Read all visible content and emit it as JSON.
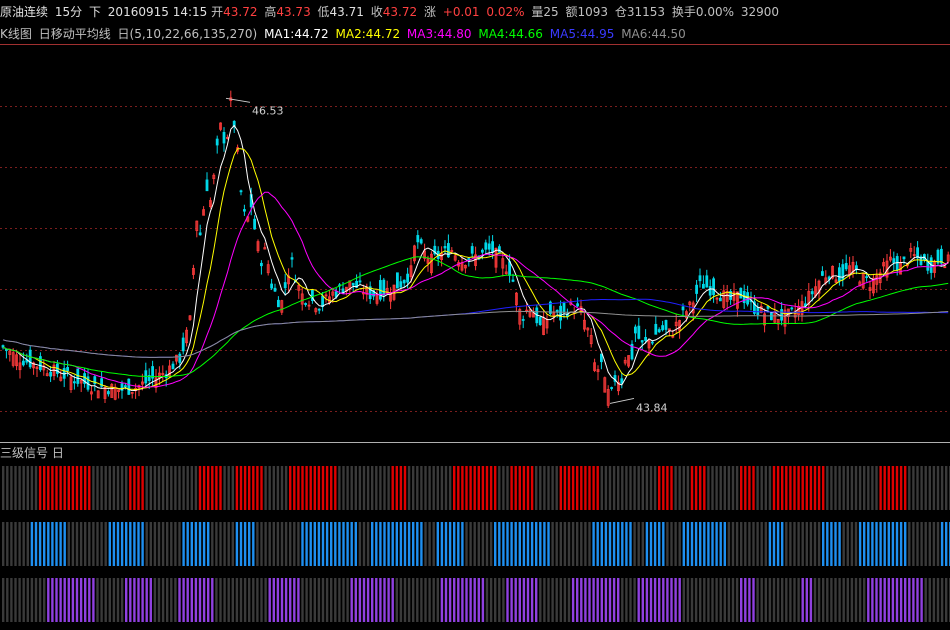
{
  "header": {
    "symbol": "原油连续",
    "period": "15分",
    "direction": "下",
    "date": "20160915",
    "time": "14:15",
    "open_label": "开",
    "open": "43.72",
    "high_label": "高",
    "high": "43.73",
    "low_label": "低",
    "low": "43.71",
    "close_label": "收",
    "close": "43.72",
    "change_label": "涨",
    "change": "+0.01",
    "change_pct": "0.02%",
    "volume_label": "量",
    "volume": "25",
    "amount_label": "额",
    "amount": "1093",
    "oi_label": "仓",
    "oi": "31153",
    "turnover_label": "换手",
    "turnover": "0.00%",
    "extra": "32900"
  },
  "indicator_bar": {
    "kline_label": "K线图",
    "ma_name": "日移动平均线",
    "ma_params": "日(5,10,22,66,135,270)",
    "ma1": "MA1:44.72",
    "ma2": "MA2:44.72",
    "ma3": "MA3:44.80",
    "ma4": "MA4:44.66",
    "ma5": "MA5:44.95",
    "ma6": "MA6:44.50"
  },
  "signal_panel": {
    "title": "三级信号",
    "icon": "日"
  },
  "colors": {
    "up": "#ff3b3b",
    "down": "#00d8e8",
    "ma1": "#ffffff",
    "ma2": "#ffff00",
    "ma3": "#ff00ff",
    "ma4": "#00ff00",
    "ma5": "#2020ff",
    "ma6": "#909090",
    "sig1": "#e00000",
    "sig2": "#1e8ff0",
    "sig3": "#9040e0",
    "sig_off": "#3a3a3a"
  },
  "chart_data": {
    "type": "candlestick",
    "y_domain": [
      43.5,
      47.0
    ],
    "annotations": [
      {
        "text": "46.53",
        "value": 46.53,
        "kind": "high"
      },
      {
        "text": "43.84",
        "value": 43.84,
        "kind": "low"
      }
    ],
    "close_path": [
      [
        0,
        44.35
      ],
      [
        15,
        44.25
      ],
      [
        30,
        44.2
      ],
      [
        45,
        44.15
      ],
      [
        60,
        44.1
      ],
      [
        75,
        44.05
      ],
      [
        90,
        44.0
      ],
      [
        105,
        43.98
      ],
      [
        120,
        43.96
      ],
      [
        135,
        43.98
      ],
      [
        150,
        44.05
      ],
      [
        165,
        44.12
      ],
      [
        180,
        44.25
      ],
      [
        190,
        44.6
      ],
      [
        195,
        45.5
      ],
      [
        200,
        45.3
      ],
      [
        205,
        45.8
      ],
      [
        210,
        45.6
      ],
      [
        215,
        46.0
      ],
      [
        220,
        46.3
      ],
      [
        225,
        46.1
      ],
      [
        230,
        46.5
      ],
      [
        235,
        46.2
      ],
      [
        240,
        45.7
      ],
      [
        245,
        45.4
      ],
      [
        250,
        45.6
      ],
      [
        255,
        45.3
      ],
      [
        260,
        45.1
      ],
      [
        265,
        45.2
      ],
      [
        270,
        44.9
      ],
      [
        280,
        44.7
      ],
      [
        290,
        45.1
      ],
      [
        300,
        44.8
      ],
      [
        310,
        44.75
      ],
      [
        320,
        44.7
      ],
      [
        330,
        44.8
      ],
      [
        340,
        44.85
      ],
      [
        350,
        44.9
      ],
      [
        360,
        44.85
      ],
      [
        370,
        44.8
      ],
      [
        380,
        44.82
      ],
      [
        390,
        44.85
      ],
      [
        400,
        44.9
      ],
      [
        410,
        45.0
      ],
      [
        415,
        45.3
      ],
      [
        420,
        45.2
      ],
      [
        430,
        45.1
      ],
      [
        440,
        45.15
      ],
      [
        450,
        45.2
      ],
      [
        460,
        45.1
      ],
      [
        470,
        45.12
      ],
      [
        480,
        45.15
      ],
      [
        490,
        45.2
      ],
      [
        500,
        45.1
      ],
      [
        510,
        45.0
      ],
      [
        515,
        44.8
      ],
      [
        520,
        44.6
      ],
      [
        530,
        44.7
      ],
      [
        540,
        44.5
      ],
      [
        550,
        44.65
      ],
      [
        560,
        44.6
      ],
      [
        570,
        44.7
      ],
      [
        580,
        44.65
      ],
      [
        590,
        44.4
      ],
      [
        595,
        44.1
      ],
      [
        600,
        44.2
      ],
      [
        605,
        43.95
      ],
      [
        610,
        43.9
      ],
      [
        615,
        44.1
      ],
      [
        620,
        44.0
      ],
      [
        625,
        44.3
      ],
      [
        630,
        44.2
      ],
      [
        635,
        44.5
      ],
      [
        640,
        44.35
      ],
      [
        650,
        44.4
      ],
      [
        660,
        44.5
      ],
      [
        670,
        44.45
      ],
      [
        680,
        44.6
      ],
      [
        690,
        44.7
      ],
      [
        700,
        44.9
      ],
      [
        710,
        44.85
      ],
      [
        720,
        44.8
      ],
      [
        730,
        44.75
      ],
      [
        740,
        44.8
      ],
      [
        750,
        44.7
      ],
      [
        760,
        44.65
      ],
      [
        770,
        44.62
      ],
      [
        780,
        44.6
      ],
      [
        790,
        44.62
      ],
      [
        800,
        44.7
      ],
      [
        810,
        44.8
      ],
      [
        820,
        44.95
      ],
      [
        830,
        45.0
      ],
      [
        840,
        44.95
      ],
      [
        850,
        45.05
      ],
      [
        860,
        44.95
      ],
      [
        870,
        44.9
      ],
      [
        880,
        45.0
      ],
      [
        890,
        45.1
      ],
      [
        900,
        45.05
      ],
      [
        910,
        45.15
      ],
      [
        920,
        45.1
      ],
      [
        930,
        45.05
      ],
      [
        940,
        45.12
      ],
      [
        950,
        45.08
      ]
    ],
    "signal_rows": 3
  }
}
